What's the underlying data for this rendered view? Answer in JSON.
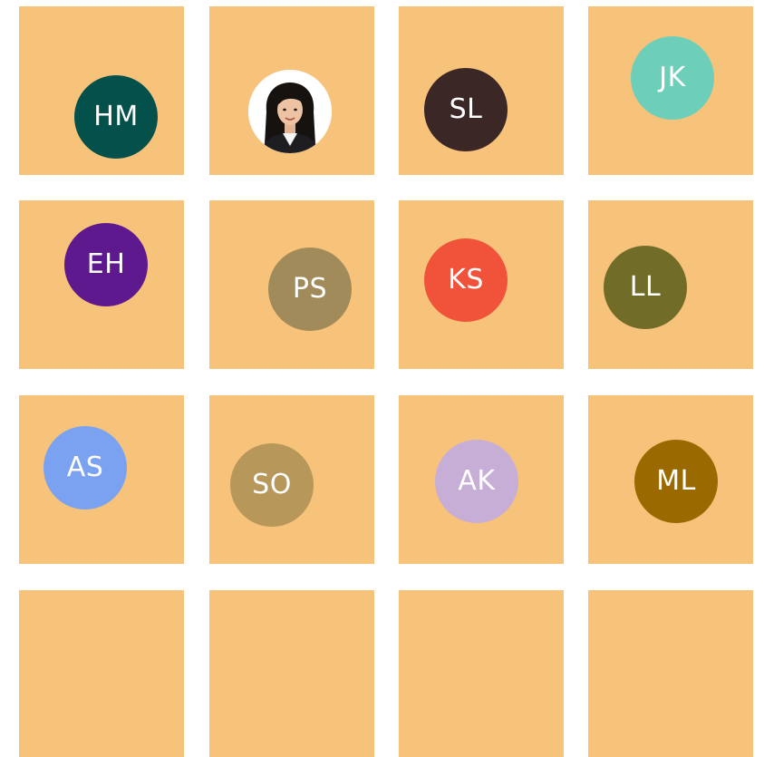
{
  "board": {
    "tiles": [
      {
        "avatar": {
          "type": "initials",
          "initials": "HM",
          "color": "#03514a"
        }
      },
      {
        "avatar": {
          "type": "photo",
          "icon": "user-photo"
        }
      },
      {
        "avatar": {
          "type": "initials",
          "initials": "SL",
          "color": "#3c2727"
        }
      },
      {
        "avatar": {
          "type": "initials",
          "initials": "JK",
          "color": "#6dcfba"
        }
      },
      {
        "avatar": {
          "type": "initials",
          "initials": "EH",
          "color": "#5f198e"
        }
      },
      {
        "avatar": {
          "type": "initials",
          "initials": "PS",
          "color": "#a18b5a"
        }
      },
      {
        "avatar": {
          "type": "initials",
          "initials": "KS",
          "color": "#f0523a"
        }
      },
      {
        "avatar": {
          "type": "initials",
          "initials": "LL",
          "color": "#716c27"
        }
      },
      {
        "avatar": {
          "type": "initials",
          "initials": "AS",
          "color": "#7ba2f0"
        }
      },
      {
        "avatar": {
          "type": "initials",
          "initials": "SO",
          "color": "#b7985a"
        }
      },
      {
        "avatar": {
          "type": "initials",
          "initials": "AK",
          "color": "#c7aed6"
        }
      },
      {
        "avatar": {
          "type": "initials",
          "initials": "ML",
          "color": "#9a6a00"
        }
      },
      {
        "avatar": null
      },
      {
        "avatar": null
      },
      {
        "avatar": null
      },
      {
        "avatar": null
      }
    ],
    "tile_color": "#f7c27a",
    "background": "#ffffff"
  }
}
